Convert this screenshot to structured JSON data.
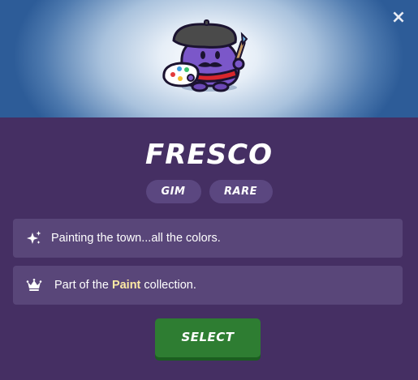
{
  "modal": {
    "close_glyph": "×",
    "title": "FRESCO",
    "tags": [
      "GIM",
      "RARE"
    ],
    "description": "Painting the town...all the colors.",
    "collection": {
      "prefix": "Part of the ",
      "name": "Paint",
      "suffix": " collection."
    },
    "select_label": "SELECT"
  },
  "icons": {
    "close": "close-icon",
    "description": "sparkles-icon",
    "collection": "crown-icon",
    "mascot": "fresco-gim-painter"
  },
  "colors": {
    "background": "#452f63",
    "card": "#594679",
    "tag": "#5b4780",
    "button": "#2e7d32",
    "highlight": "#fde9a3"
  }
}
